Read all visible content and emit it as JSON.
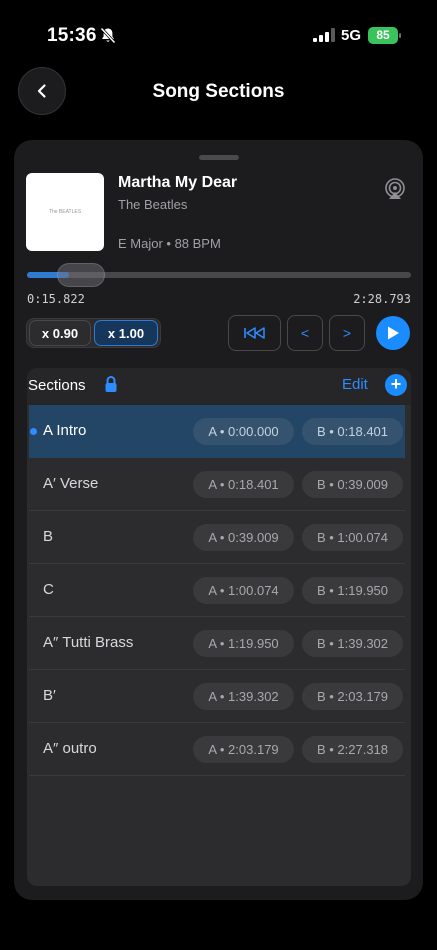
{
  "status": {
    "time": "15:36",
    "network": "5G",
    "battery": "85"
  },
  "header": {
    "title": "Song Sections"
  },
  "song": {
    "title": "Martha My Dear",
    "artist": "The Beatles",
    "meta": "E Major • 88 BPM",
    "artwork_text": "The BEATLES"
  },
  "playback": {
    "elapsed": "0:15.822",
    "total": "2:28.793",
    "progress_fraction": 0.11,
    "speeds": [
      "x 0.90",
      "x 1.00"
    ],
    "selected_speed": "x 1.00",
    "prev_label": "<",
    "next_label": ">"
  },
  "sections_panel": {
    "label": "Sections",
    "edit_label": "Edit",
    "add_label": "+",
    "rows": [
      {
        "name": "A Intro",
        "a": "A • 0:00.000",
        "b": "B • 0:18.401",
        "active": true
      },
      {
        "name": "A′ Verse",
        "a": "A • 0:18.401",
        "b": "B • 0:39.009",
        "active": false
      },
      {
        "name": "B",
        "a": "A • 0:39.009",
        "b": "B • 1:00.074",
        "active": false
      },
      {
        "name": "C",
        "a": "A • 1:00.074",
        "b": "B • 1:19.950",
        "active": false
      },
      {
        "name": "A″ Tutti Brass",
        "a": "A • 1:19.950",
        "b": "B • 1:39.302",
        "active": false
      },
      {
        "name": "B′",
        "a": "A • 1:39.302",
        "b": "B • 2:03.179",
        "active": false
      },
      {
        "name": "A″ outro",
        "a": "A • 2:03.179",
        "b": "B • 2:27.318",
        "active": false
      }
    ]
  },
  "colors": {
    "accent": "#1a8cff",
    "active_row": "#244666",
    "battery": "#3ac25b"
  }
}
